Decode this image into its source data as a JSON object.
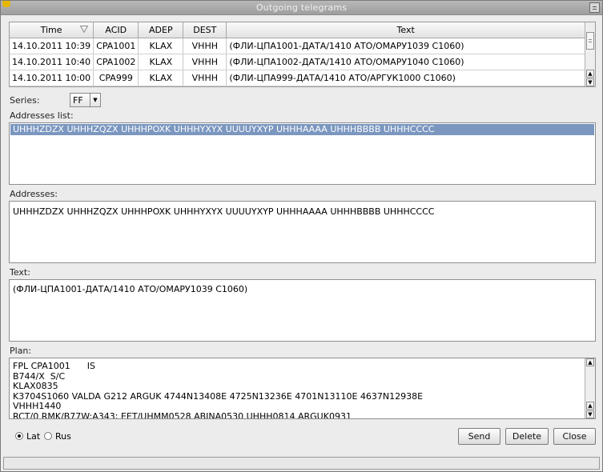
{
  "window": {
    "title": "Outgoing telegrams"
  },
  "table": {
    "columns": [
      "Time",
      "ACID",
      "ADEP",
      "DEST",
      "Text"
    ],
    "rows": [
      {
        "time": "14.10.2011 10:39",
        "acid": "CPA1001",
        "adep": "KLAX",
        "dest": "VHHH",
        "text": "(ФЛИ-ЦПА1001-ДАТА/1410 АТО/ОМАРУ1039 С1060)"
      },
      {
        "time": "14.10.2011 10:40",
        "acid": "CPA1002",
        "adep": "KLAX",
        "dest": "VHHH",
        "text": "(ФЛИ-ЦПА1002-ДАТА/1410 АТО/ОМАРУ1040 С1060)"
      },
      {
        "time": "14.10.2011 10:00",
        "acid": "CPA999",
        "adep": "KLAX",
        "dest": "VHHH",
        "text": "(ФЛИ-ЦПА999-ДАТА/1410 АТО/АРГУК1000 С1060)"
      }
    ]
  },
  "series": {
    "label": "Series:",
    "value": "FF"
  },
  "addresses_list": {
    "label": "Addresses list:",
    "selected": "UHHHZDZX UHHHZQZX UHHHPOXK UHHHYXYX UUUUYXYP UHHHAAAA UHHHBBBB UHHHCCCC"
  },
  "addresses": {
    "label": "Addresses:",
    "value": "UHHHZDZX UHHHZQZX UHHHPOXK UHHHYXYX UUUUYXYP UHHHAAAA UHHHBBBB UHHHCCCC"
  },
  "text": {
    "label": "Text:",
    "value": "(ФЛИ-ЦПА1001-ДАТА/1410 АТО/ОМАРУ1039 С1060)"
  },
  "plan": {
    "label": "Plan:",
    "lines": [
      "FPL CPA1001      IS",
      "B744/X  S/C",
      "KLAX0835",
      "K3704S1060 VALDA G212 ARGUK 4744N13408E 4725N13236E 4701N13110E 4637N12938E",
      "VHHH1440",
      "RCT/0 RMK/B77W:A343; EET/UHMM0528 ABINA0530 UHHH0814 ARGUK0931"
    ]
  },
  "language": {
    "lat_label": "Lat",
    "rus_label": "Rus",
    "selected": "Lat"
  },
  "buttons": {
    "send": "Send",
    "delete": "Delete",
    "close": "Close"
  }
}
